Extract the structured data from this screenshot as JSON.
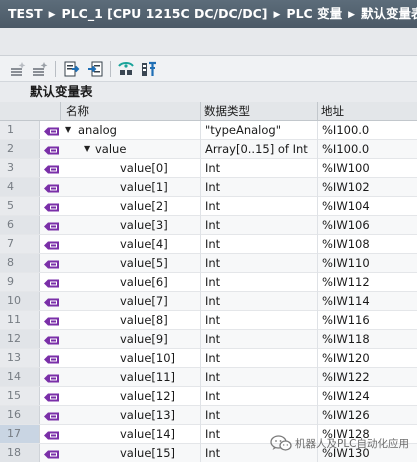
{
  "breadcrumb": [
    "TEST",
    "PLC_1 [CPU 1215C DC/DC/DC]",
    "PLC 变量",
    "默认变量表"
  ],
  "toolbar": {
    "buttons": [
      "add-row-icon",
      "insert-row-icon",
      "export-icon",
      "import-icon",
      "monitor-icon",
      "monitor-all-icon"
    ]
  },
  "table": {
    "title": "默认变量表",
    "columns": {
      "name": "名称",
      "datatype": "数据类型",
      "address": "地址"
    },
    "rows": [
      {
        "num": "1",
        "name": "analog",
        "datatype": "\"typeAnalog\"",
        "address": "%I100.0",
        "level": 0,
        "expander": "expanded"
      },
      {
        "num": "2",
        "name": "value",
        "datatype": "Array[0..15] of Int",
        "address": "%I100.0",
        "level": 1,
        "expander": "expanded"
      },
      {
        "num": "3",
        "name": "value[0]",
        "datatype": "Int",
        "address": "%IW100",
        "level": 2,
        "expander": ""
      },
      {
        "num": "4",
        "name": "value[1]",
        "datatype": "Int",
        "address": "%IW102",
        "level": 2,
        "expander": ""
      },
      {
        "num": "5",
        "name": "value[2]",
        "datatype": "Int",
        "address": "%IW104",
        "level": 2,
        "expander": ""
      },
      {
        "num": "6",
        "name": "value[3]",
        "datatype": "Int",
        "address": "%IW106",
        "level": 2,
        "expander": ""
      },
      {
        "num": "7",
        "name": "value[4]",
        "datatype": "Int",
        "address": "%IW108",
        "level": 2,
        "expander": ""
      },
      {
        "num": "8",
        "name": "value[5]",
        "datatype": "Int",
        "address": "%IW110",
        "level": 2,
        "expander": ""
      },
      {
        "num": "9",
        "name": "value[6]",
        "datatype": "Int",
        "address": "%IW112",
        "level": 2,
        "expander": ""
      },
      {
        "num": "10",
        "name": "value[7]",
        "datatype": "Int",
        "address": "%IW114",
        "level": 2,
        "expander": ""
      },
      {
        "num": "11",
        "name": "value[8]",
        "datatype": "Int",
        "address": "%IW116",
        "level": 2,
        "expander": ""
      },
      {
        "num": "12",
        "name": "value[9]",
        "datatype": "Int",
        "address": "%IW118",
        "level": 2,
        "expander": ""
      },
      {
        "num": "13",
        "name": "value[10]",
        "datatype": "Int",
        "address": "%IW120",
        "level": 2,
        "expander": ""
      },
      {
        "num": "14",
        "name": "value[11]",
        "datatype": "Int",
        "address": "%IW122",
        "level": 2,
        "expander": ""
      },
      {
        "num": "15",
        "name": "value[12]",
        "datatype": "Int",
        "address": "%IW124",
        "level": 2,
        "expander": ""
      },
      {
        "num": "16",
        "name": "value[13]",
        "datatype": "Int",
        "address": "%IW126",
        "level": 2,
        "expander": ""
      },
      {
        "num": "17",
        "name": "value[14]",
        "datatype": "Int",
        "address": "%IW128",
        "level": 2,
        "expander": ""
      },
      {
        "num": "18",
        "name": "value[15]",
        "datatype": "Int",
        "address": "%IW130",
        "level": 2,
        "expander": ""
      }
    ]
  },
  "watermark": {
    "text": "机器人及PLC自动化应用"
  },
  "colors": {
    "title_bar": "#5c6c7a",
    "tag_icon": "#7a2fa8",
    "row_number": "#767c83"
  }
}
